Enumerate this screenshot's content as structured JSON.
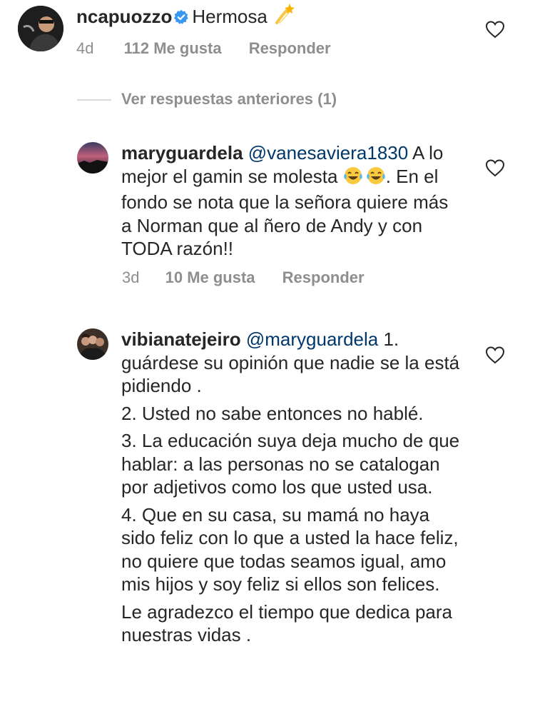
{
  "comments": [
    {
      "username": "ncapuozzo",
      "verified": true,
      "text": "Hermosa",
      "emoji": "dizzy-emoji",
      "time": "4d",
      "likes": "112 Me gusta",
      "reply": "Responder"
    },
    {
      "username": "maryguardela",
      "mention": "@vanesaviera1830",
      "text_before_emoji": "A lo mejor el gamin se molesta",
      "emoji": "laughing-tears-emoji",
      "text_after_emoji": ". En el fondo se nota que la señora quiere más a Norman que al ñero de Andy y con TODA razón!!",
      "time": "3d",
      "likes": "10 Me gusta",
      "reply": "Responder"
    },
    {
      "username": "vibianatejeiro",
      "mention": "@maryguardela",
      "paragraphs": [
        "1. guárdese su opinión que nadie se la está pidiendo .",
        "2. Usted no sabe entonces no hablé.",
        "3. La educación suya deja mucho de que hablar: a las personas no se catalogan por adjetivos como los que usted usa.",
        "4. Que en su casa, su mamá no haya sido feliz con lo que a usted la hace feliz, no quiere que todas seamos igual, amo mis hijos y soy feliz si ellos son felices.",
        "Le agradezco el tiempo que dedica para nuestras vidas ."
      ]
    }
  ],
  "view_previous": "Ver respuestas anteriores (1)",
  "colors": {
    "text": "#262626",
    "meta": "#8e8e8e",
    "mention": "#00376b",
    "verified": "#3897f0",
    "divider": "#dbdbdb"
  }
}
